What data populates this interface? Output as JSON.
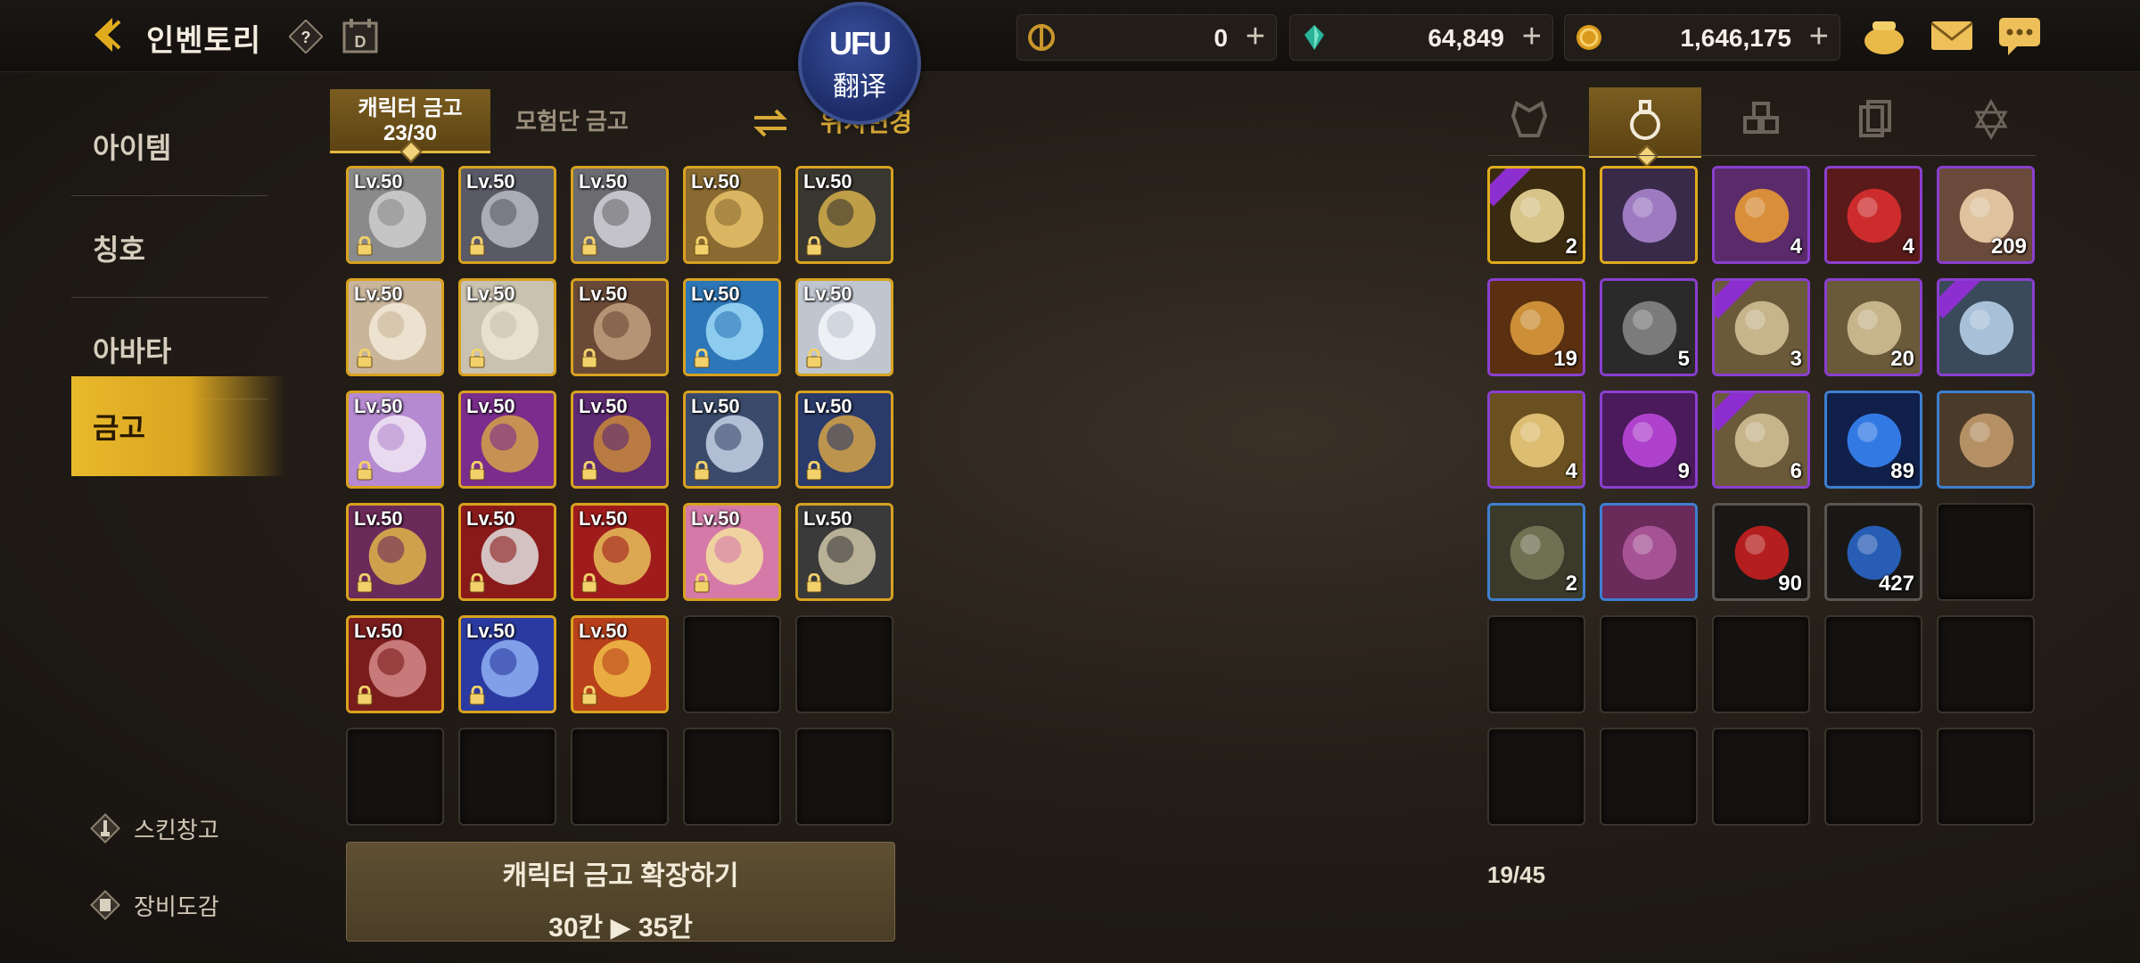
{
  "header": {
    "title": "인벤토리",
    "currencies": [
      {
        "icon": "crown-coin-icon",
        "value": "0",
        "plus": "+"
      },
      {
        "icon": "green-gem-icon",
        "value": "64,849",
        "plus": "+"
      },
      {
        "icon": "gold-coin-icon",
        "value": "1,646,175",
        "plus": "+"
      }
    ]
  },
  "translate": {
    "logo": "UFU",
    "label": "翻译"
  },
  "sidebar": {
    "items": [
      "아이템",
      "칭호",
      "아바타",
      "금고"
    ],
    "links": [
      "스킨창고",
      "장비도감"
    ]
  },
  "vault": {
    "tab_character_line1": "캐릭터 금고",
    "tab_character_line2": "23/30",
    "tab_adventure": "모험단 금고",
    "swap_label": "위치변경",
    "level_label": "Lv.50",
    "expand_line1": "캐릭터 금고 확장하기",
    "expand_line2": "30칸 ▶ 35칸"
  },
  "inventory": {
    "count": "19/45",
    "quantities": [
      "2",
      "",
      "4",
      "4",
      "209",
      "19",
      "5",
      "3",
      "20",
      "",
      "4",
      "9",
      "6",
      "89",
      "",
      "2",
      "",
      "90",
      "427"
    ]
  },
  "colors": {
    "accent": "#e0ac1e",
    "active_tab": "#d9a520",
    "purple": "#8a3fcf",
    "blue": "#3e7fd0"
  }
}
